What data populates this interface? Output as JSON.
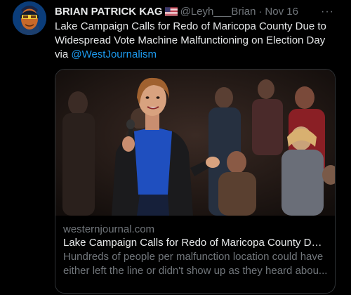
{
  "tweet": {
    "author_name": "BRIAN PATRICK KAG",
    "handle": "@Leyh___Brian",
    "separator": "·",
    "date": "Nov 16",
    "more_icon": "···",
    "text": "Lake Campaign Calls for Redo of Maricopa County Due to Widespread Vote Machine Malfunctioning on Election Day via ",
    "mention": "@WestJournalism"
  },
  "card": {
    "domain": "westernjournal.com",
    "title": "Lake Campaign Calls for Redo of Maricopa County Due...",
    "description": "Hundreds of people per malfunction location could have either left the line or didn't show up as they heard abou..."
  },
  "colors": {
    "background": "#000000",
    "text_primary": "#e7e9ea",
    "text_secondary": "#71767b",
    "link": "#1d9bf0",
    "border": "#2f3336"
  },
  "icons": {
    "avatar": "masked-superhero-avatar",
    "flag": "us-flag-icon",
    "more": "more-options-icon"
  }
}
